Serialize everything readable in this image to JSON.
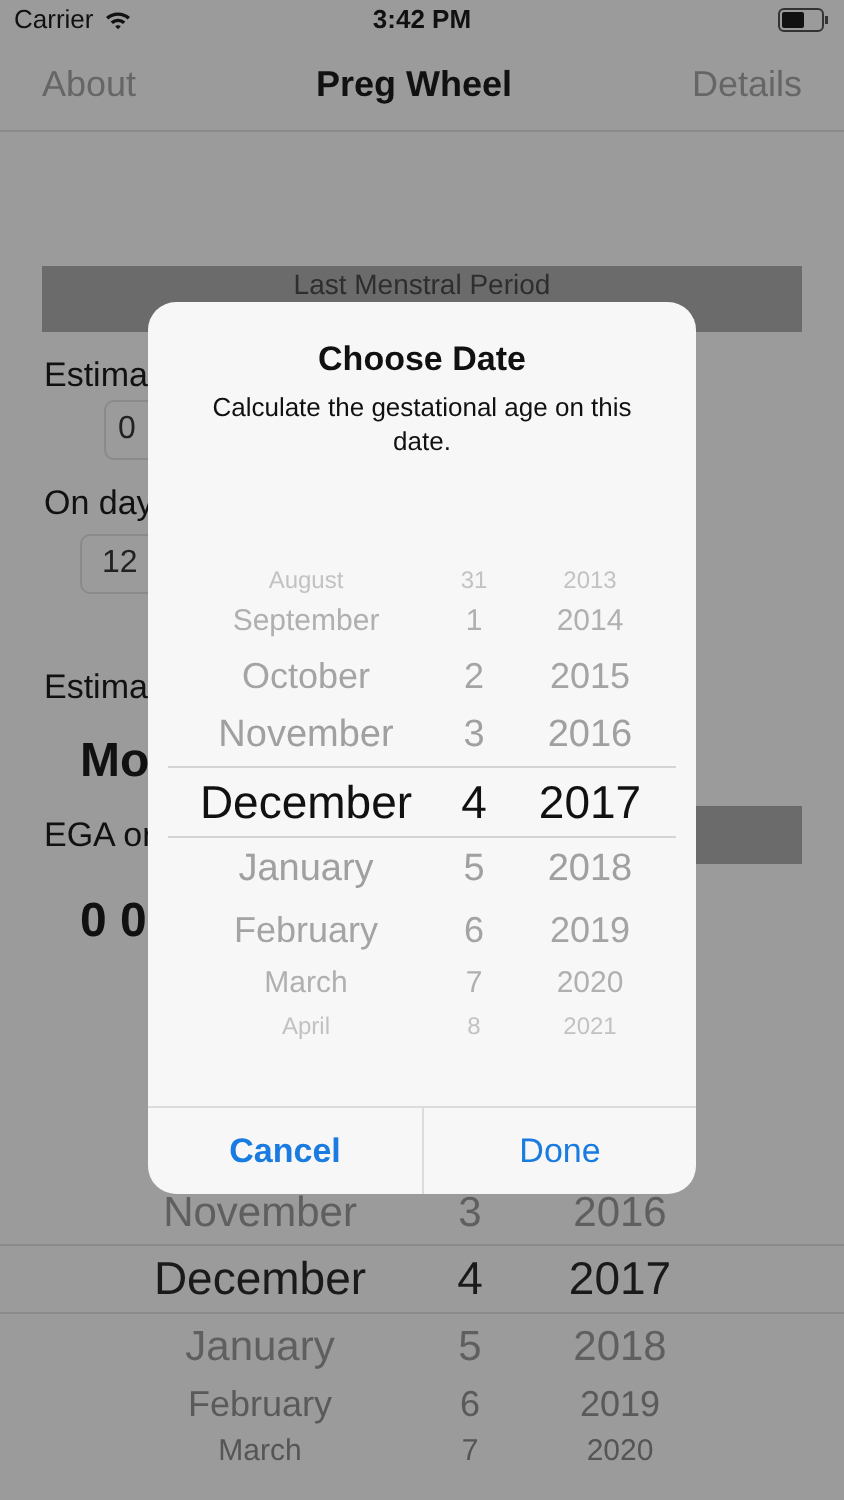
{
  "status_bar": {
    "carrier": "Carrier",
    "time": "3:42 PM"
  },
  "nav": {
    "left": "About",
    "title": "Preg Wheel",
    "right": "Details"
  },
  "background": {
    "section_header": "Last Menstral Period",
    "label_1": "Estima",
    "field_1": "0",
    "label_2": "On day",
    "field_2": "12",
    "label_3": "Estima",
    "value_1": "Mo",
    "label_4": "EGA or",
    "value_2": "0 0"
  },
  "background_picker": {
    "rows": [
      {
        "month": "November",
        "day": "3",
        "year": "2016",
        "selected": false
      },
      {
        "month": "December",
        "day": "4",
        "year": "2017",
        "selected": true
      },
      {
        "month": "January",
        "day": "5",
        "year": "2018",
        "selected": false
      },
      {
        "month": "February",
        "day": "6",
        "year": "2019",
        "selected": false
      },
      {
        "month": "March",
        "day": "7",
        "year": "2020",
        "selected": false
      }
    ]
  },
  "dialog": {
    "title": "Choose Date",
    "message": "Calculate the gestational age on this date.",
    "picker": {
      "rows": [
        {
          "month": "August",
          "day": "31",
          "year": "2013",
          "selected": false
        },
        {
          "month": "September",
          "day": "1",
          "year": "2014",
          "selected": false
        },
        {
          "month": "October",
          "day": "2",
          "year": "2015",
          "selected": false
        },
        {
          "month": "November",
          "day": "3",
          "year": "2016",
          "selected": false
        },
        {
          "month": "December",
          "day": "4",
          "year": "2017",
          "selected": true
        },
        {
          "month": "January",
          "day": "5",
          "year": "2018",
          "selected": false
        },
        {
          "month": "February",
          "day": "6",
          "year": "2019",
          "selected": false
        },
        {
          "month": "March",
          "day": "7",
          "year": "2020",
          "selected": false
        },
        {
          "month": "April",
          "day": "8",
          "year": "2021",
          "selected": false
        }
      ]
    },
    "buttons": [
      {
        "label": "Cancel",
        "kind": "cancel"
      },
      {
        "label": "Done",
        "kind": "default"
      }
    ]
  }
}
